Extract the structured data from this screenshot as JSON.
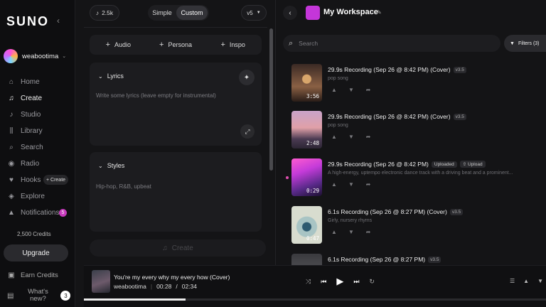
{
  "sidebar": {
    "logo": "SUNO",
    "user": "weabootima",
    "nav": [
      {
        "label": "Home",
        "icon": "home-icon",
        "glyph": "⌂"
      },
      {
        "label": "Create",
        "icon": "music-note-icon",
        "glyph": "♫"
      },
      {
        "label": "Studio",
        "icon": "studio-icon",
        "glyph": "♪"
      },
      {
        "label": "Library",
        "icon": "library-icon",
        "glyph": "⫼"
      },
      {
        "label": "Search",
        "icon": "search-icon",
        "glyph": "⌕"
      },
      {
        "label": "Radio",
        "icon": "radio-icon",
        "glyph": "◉"
      },
      {
        "label": "Hooks",
        "icon": "hooks-icon",
        "glyph": "♥"
      },
      {
        "label": "Explore",
        "icon": "compass-icon",
        "glyph": "◈"
      },
      {
        "label": "Notifications",
        "icon": "bell-icon",
        "glyph": "🔔"
      }
    ],
    "hooks_create": "+ Create",
    "notifications_count": "5",
    "credits": "2,500 Credits",
    "upgrade": "Upgrade",
    "earn_credits": "Earn Credits",
    "whats_new": "What's new?",
    "whats_new_count": "3"
  },
  "create": {
    "count": "2.5k",
    "mode_simple": "Simple",
    "mode_custom": "Custom",
    "version": "v5",
    "add_audio": "Audio",
    "add_persona": "Persona",
    "add_inspo": "Inspo",
    "lyrics_label": "Lyrics",
    "lyrics_placeholder": "Write some lyrics (leave empty for instrumental)",
    "styles_label": "Styles",
    "styles_placeholder": "Hip-hop, R&B, upbeat",
    "create_button": "Create"
  },
  "workspace": {
    "title": "My Workspace",
    "search_placeholder": "Search",
    "filters": "Filters (3)",
    "songs": [
      {
        "title": "29.9s Recording (Sep 26 @ 8:42 PM) (Cover)",
        "version": "v3.5",
        "desc": "pop song",
        "duration": "3:56",
        "uploaded": "",
        "upload": ""
      },
      {
        "title": "29.9s Recording (Sep 26 @ 8:42 PM) (Cover)",
        "version": "v3.5",
        "desc": "pop song",
        "duration": "2:48",
        "uploaded": "",
        "upload": ""
      },
      {
        "title": "29.9s Recording (Sep 26 @ 8:42 PM)",
        "version": "",
        "desc": "A high-energy, uptempo electronic dance track with a driving beat and a prominent...",
        "duration": "0:29",
        "uploaded": "Uploaded",
        "upload": "Upload"
      },
      {
        "title": "6.1s Recording (Sep 26 @ 8:27 PM) (Cover)",
        "version": "v3.5",
        "desc": "Girly, nursery rhyms",
        "duration": "0:47",
        "uploaded": "",
        "upload": ""
      },
      {
        "title": "6.1s Recording (Sep 26 @ 8:27 PM)",
        "version": "v3.5",
        "desc": "",
        "duration": "",
        "uploaded": "",
        "upload": ""
      }
    ]
  },
  "player": {
    "title": "You're my every why my every how (Cover)",
    "artist": "weabootima",
    "current": "00:28",
    "total": "02:34",
    "progress": 0.22
  },
  "colors": {
    "accent": "#c436d9",
    "background": "#141416",
    "sidebar": "#0e0e10"
  }
}
